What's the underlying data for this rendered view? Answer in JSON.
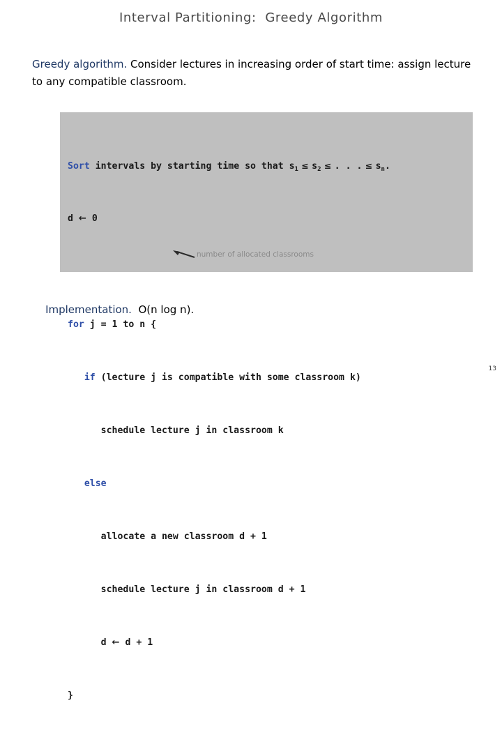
{
  "slide": {
    "title": "Interval Partitioning:  Greedy Algorithm",
    "page_number": "13",
    "code_block_color": "#bfbfbf",
    "accent_color": "#1f3864",
    "keyword_color": "#2f4fa8",
    "title_color": "#4a4a4a",
    "annotation_color": "#8a8a8a"
  },
  "intro": {
    "label": "Greedy algorithm.",
    "text": "  Consider lectures in increasing order of start time: assign lecture to any compatible classroom."
  },
  "code": {
    "line1_keyword": "Sort",
    "line1_rest_a": " intervals by starting time so that s",
    "line1_sub_1": "1",
    "line1_le_1": " ≤ ",
    "line1_s2": "s",
    "line1_sub_2": "2",
    "line1_le_2": " ≤ ",
    "line1_dots": ". . .",
    "line1_le_3": " ≤ ",
    "line1_sn": "s",
    "line1_sub_n": "n",
    "line1_end": ".",
    "line2_var": "d ",
    "line2_arrow": "←",
    "line2_val": " 0",
    "line3_keyword": "for",
    "line3_rest": " j = 1 to n {",
    "line4_indent": "   ",
    "line4_keyword": "if",
    "line4_rest": " (lecture j is compatible with some classroom k)",
    "line5": "      schedule lecture j in classroom k",
    "line6_indent": "   ",
    "line6_keyword": "else",
    "line7": "      allocate a new classroom d + 1",
    "line8": "      schedule lecture j in classroom d + 1",
    "line9_indent": "      ",
    "line9_var": "d ",
    "line9_arrow": "←",
    "line9_val": " d + 1",
    "line10": "}"
  },
  "annotation": {
    "text": "number of allocated classrooms"
  },
  "implementation": {
    "label": "Implementation.",
    "value": "  O(n log n)."
  }
}
